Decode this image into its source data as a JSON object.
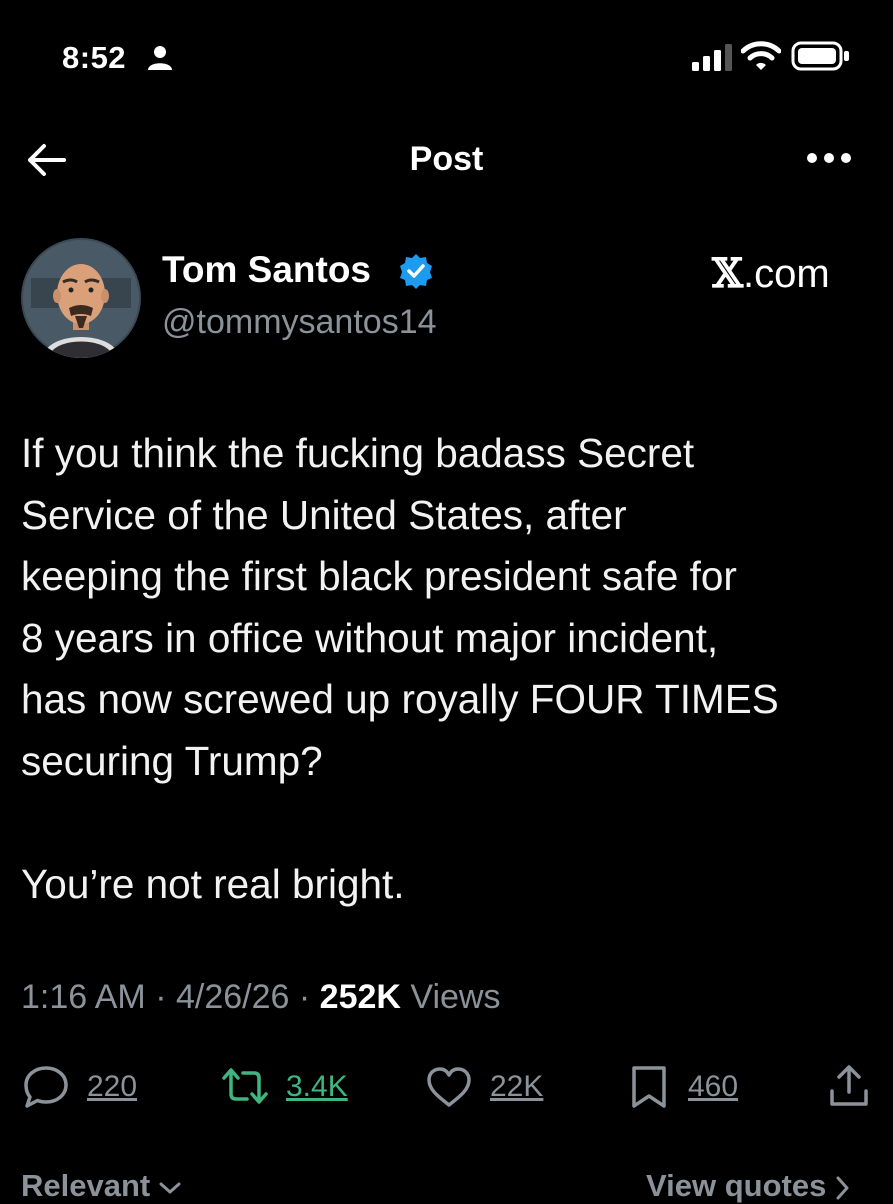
{
  "status_bar": {
    "time": "8:52"
  },
  "header": {
    "title": "Post"
  },
  "author": {
    "display_name": "Tom Santos",
    "handle": "@tommysantos14",
    "verified": true
  },
  "brand": {
    "x_glyph": "𝕏",
    "suffix": ".com"
  },
  "post": {
    "lines": [
      "If you think the fucking badass Secret",
      "Service of the United States, after",
      "keeping the first black president safe for",
      "8 years in office without major incident,",
      "has now screwed up royally FOUR TIMES",
      "securing Trump?",
      "",
      "You’re not real bright."
    ]
  },
  "meta": {
    "time": "1:16 AM",
    "date": "4/26/26",
    "separator": "·",
    "views_count": "252K",
    "views_label": "Views"
  },
  "actions": {
    "replies": "220",
    "reposts": "3.4K",
    "likes": "22K",
    "bookmarks": "460"
  },
  "footer": {
    "sort_label": "Relevant",
    "quotes_label": "View quotes"
  },
  "colors": {
    "background": "#000000",
    "verified": "#1d9bf0",
    "repost": "#3fb680",
    "secondary_text": "#8b9299"
  }
}
